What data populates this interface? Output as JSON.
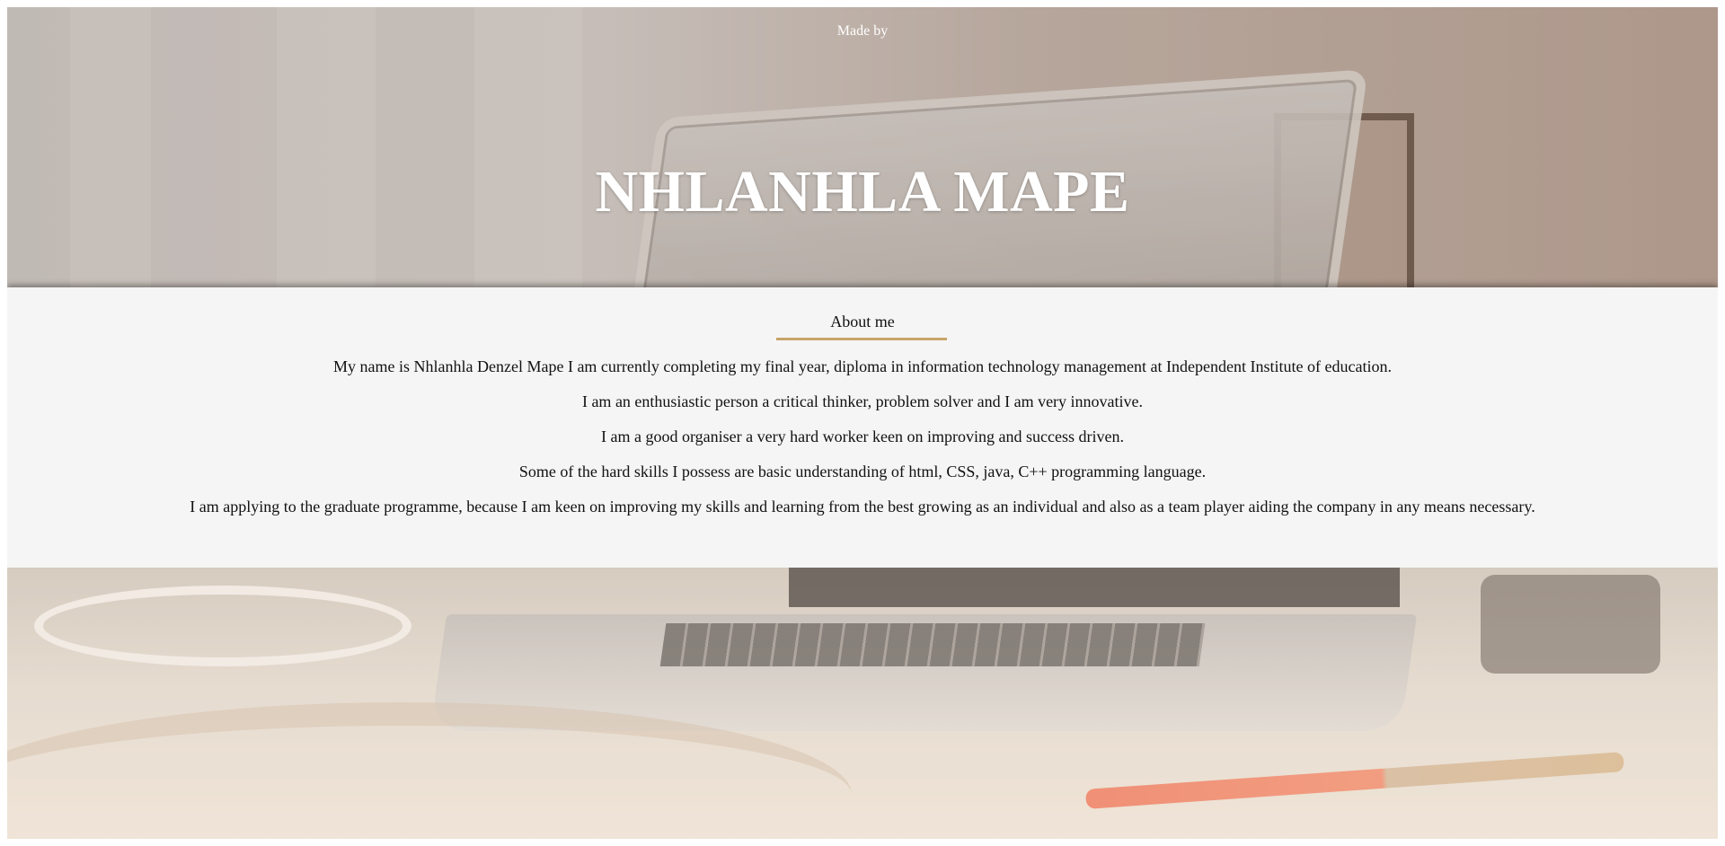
{
  "header": {
    "made_by": "Made by",
    "name": "NHLANHLA MAPE"
  },
  "about": {
    "heading": "About me",
    "accent_color": "#c8a46a",
    "lines": [
      "My name is Nhlanhla Denzel Mape I am currently completing my final year, diploma in information technology management at Independent Institute of education.",
      "I am an enthusiastic person a critical thinker, problem solver and I am very innovative.",
      "I am a good organiser a very hard worker keen on improving and success driven.",
      "Some of the hard skills I possess are basic understanding of html, CSS, java, C++ programming language.",
      "I am applying to the graduate programme, because I am keen on improving my skills and learning from the best growing as an individual and also as a team player aiding the company in any means necessary."
    ]
  }
}
